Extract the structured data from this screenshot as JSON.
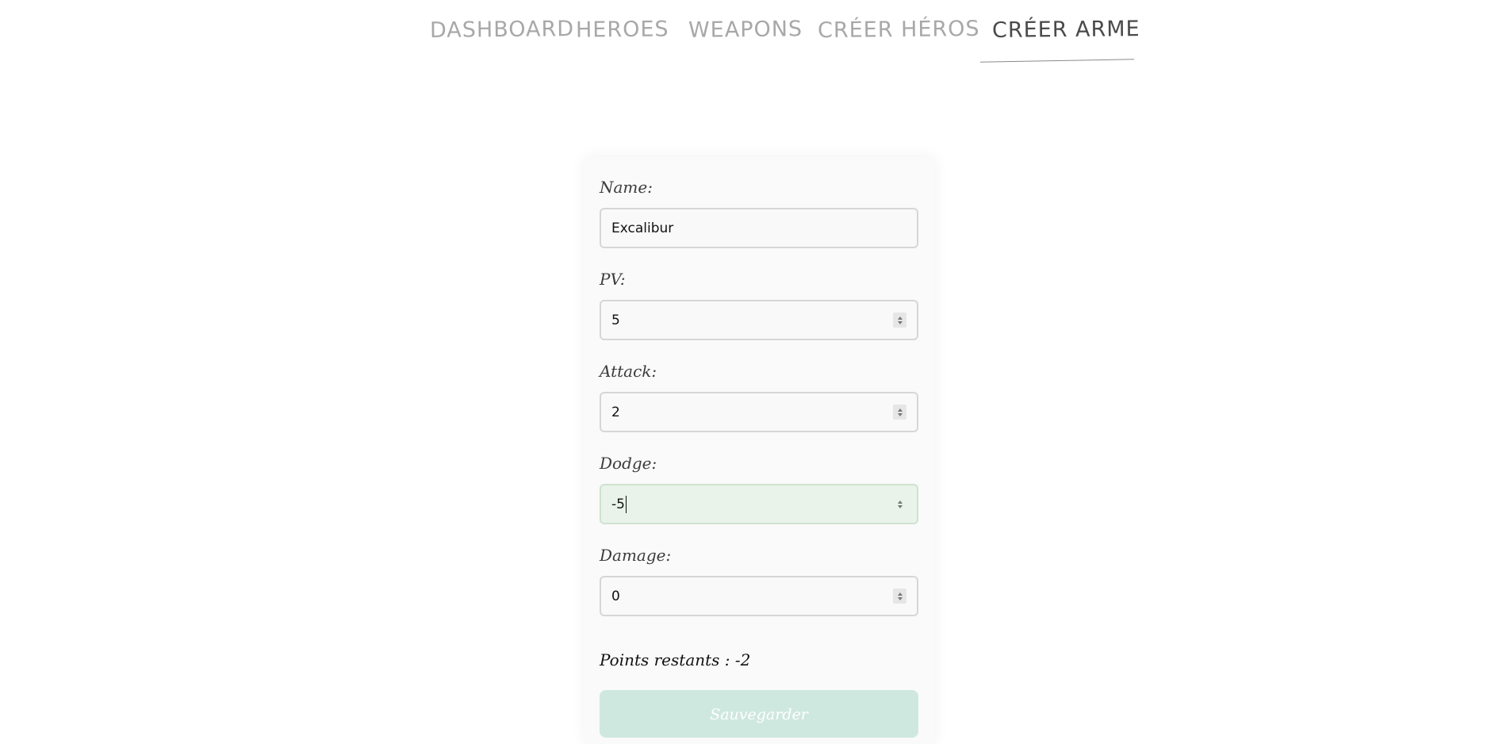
{
  "nav": {
    "items": [
      {
        "label": "DASHBOARD"
      },
      {
        "label": "HEROES"
      },
      {
        "label": "WEAPONS"
      },
      {
        "label": "CRÉER HÉROS"
      },
      {
        "label": "CRÉER ARME"
      }
    ],
    "active_index": 4
  },
  "form": {
    "fields": [
      {
        "label": "Name:",
        "value": "Excalibur",
        "type": "text"
      },
      {
        "label": "PV:",
        "value": "5",
        "type": "number"
      },
      {
        "label": "Attack:",
        "value": "2",
        "type": "number"
      },
      {
        "label": "Dodge:",
        "value": "-5",
        "type": "number",
        "focused": true
      },
      {
        "label": "Damage:",
        "value": "0",
        "type": "number"
      }
    ],
    "points_remaining": "Points restants : -2",
    "save_label": "Sauvegarder"
  },
  "colors": {
    "focus_bg": "#e9f3e9",
    "button_disabled": "#cfe8df",
    "nav_active": "#4a4a4a",
    "nav_inactive": "#a8a8a8"
  }
}
